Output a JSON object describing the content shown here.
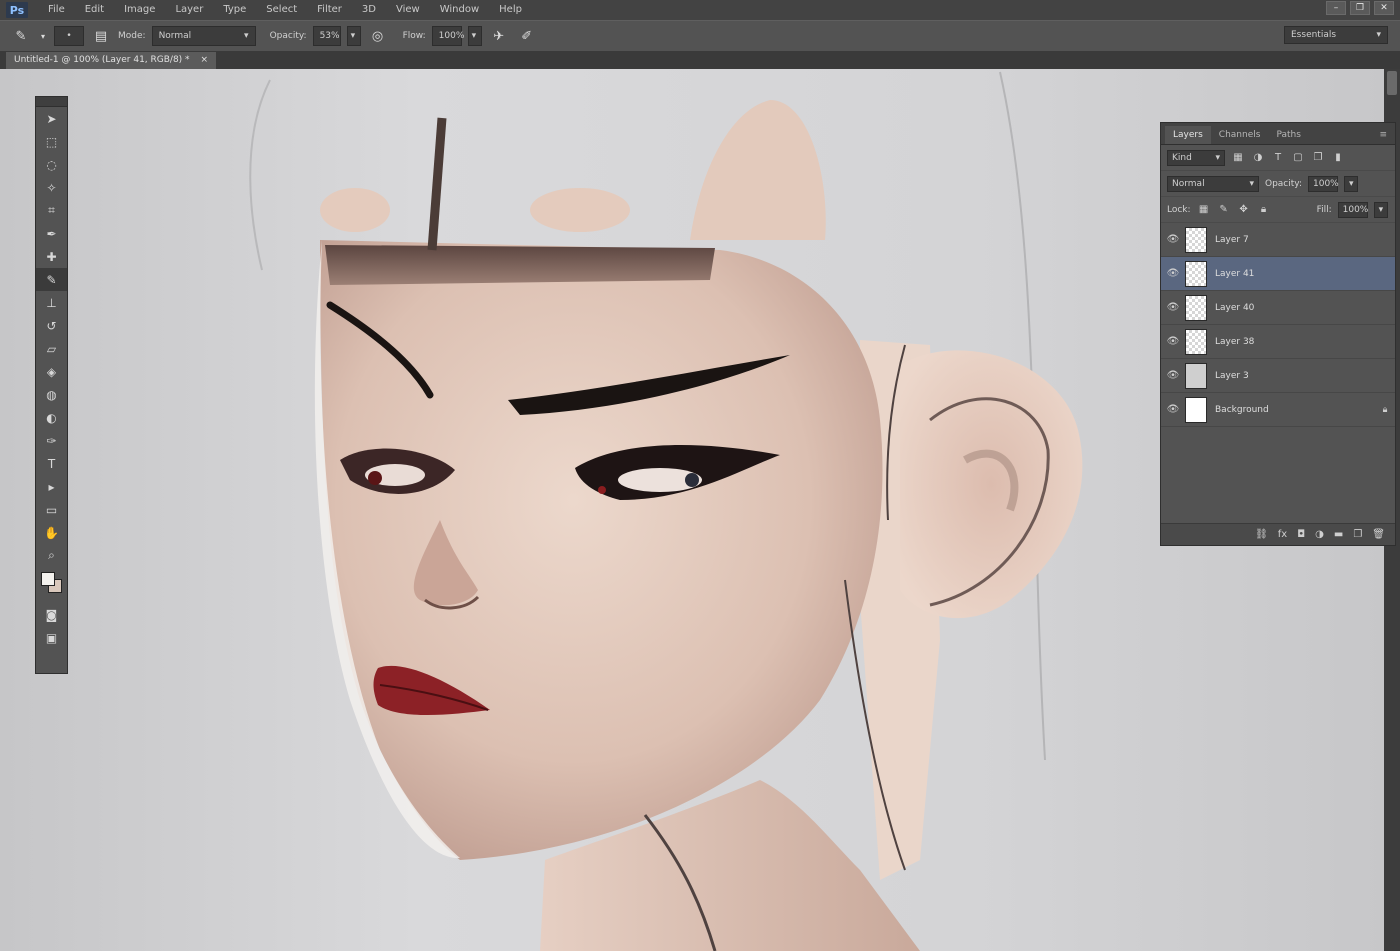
{
  "app": {
    "logo": "Ps"
  },
  "menu": [
    "File",
    "Edit",
    "Image",
    "Layer",
    "Type",
    "Select",
    "Filter",
    "3D",
    "View",
    "Window",
    "Help"
  ],
  "window_controls": [
    "–",
    "❐",
    "✕"
  ],
  "options": {
    "mode_label": "Mode:",
    "mode_value": "Normal",
    "opacity_label": "Opacity:",
    "opacity_value": "53%",
    "flow_label": "Flow:",
    "flow_value": "100%"
  },
  "workspace": {
    "value": "Essentials"
  },
  "document_tab": {
    "label": "Untitled-1 @ 100% (Layer 41, RGB/8) *"
  },
  "layers_panel": {
    "tabs": [
      "Layers",
      "Channels",
      "Paths"
    ],
    "filter_value": "Kind",
    "blend_mode": "Normal",
    "opacity_label": "Opacity:",
    "opacity_value": "100%",
    "lock_label": "Lock:",
    "fill_label": "Fill:",
    "fill_value": "100%",
    "layers": [
      {
        "name": "Layer 7",
        "thumb": "transparent",
        "selected": false,
        "locked": false
      },
      {
        "name": "Layer 41",
        "thumb": "transparent",
        "selected": true,
        "locked": false
      },
      {
        "name": "Layer 40",
        "thumb": "transparent",
        "selected": false,
        "locked": false
      },
      {
        "name": "Layer 38",
        "thumb": "transparent",
        "selected": false,
        "locked": false
      },
      {
        "name": "Layer 3",
        "thumb": "solid-gray",
        "selected": false,
        "locked": false
      },
      {
        "name": "Background",
        "thumb": "solid-white",
        "selected": false,
        "locked": true
      }
    ]
  },
  "colors": {
    "skin": "#e8cfc2",
    "skin_shadow": "#c7a696",
    "canvas_bg": "#d4d4d6",
    "lips": "#8c2126",
    "brow": "#1a1412",
    "selected_layer": "#5a6780"
  }
}
